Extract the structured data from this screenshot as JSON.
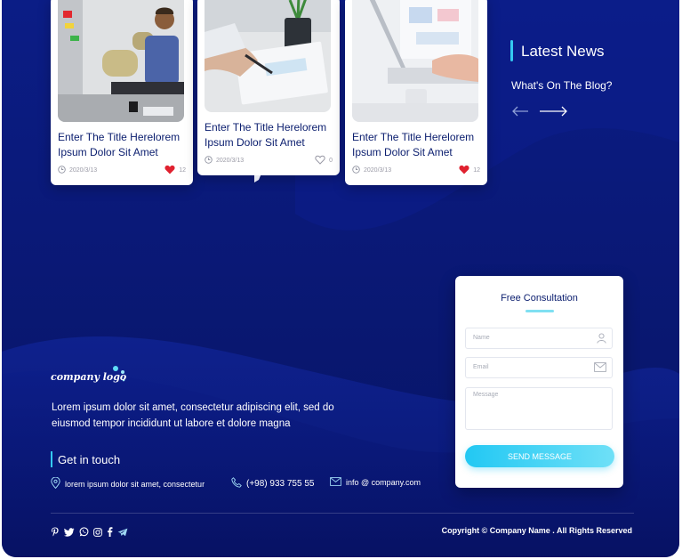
{
  "blog": {
    "cards": [
      {
        "title": "Enter The Title Herelorem Ipsum Dolor Sit Amet",
        "date": "2020/3/13",
        "likes": "12",
        "liked": true
      },
      {
        "title": "Enter The Title Herelorem Ipsum Dolor Sit Amet",
        "date": "2020/3/13",
        "likes": "0",
        "liked": false
      },
      {
        "title": "Enter The Title Herelorem Ipsum Dolor Sit Amet",
        "date": "2020/3/13",
        "likes": "12",
        "liked": true
      }
    ]
  },
  "news": {
    "title": "Latest News",
    "subtitle": "What's On The Blog?"
  },
  "consultation": {
    "title": "Free Consultation",
    "name_placeholder": "Name",
    "email_placeholder": "Email",
    "message_placeholder": "Message",
    "submit_label": "SEND MESSAGE"
  },
  "footer": {
    "logo_text": "company logo",
    "about": "Lorem ipsum dolor sit amet, consectetur adipiscing elit, sed do eiusmod tempor incididunt ut labore et dolore magna",
    "get_in_touch": "Get in touch",
    "address": "lorem ipsum dolor sit amet, consectetur",
    "phone": "(+98) 933 755 55",
    "email": "info @ company.com",
    "copyright": "Copyright © Company Name . All Rights Reserved",
    "social_icons": [
      "pinterest-icon",
      "twitter-icon",
      "whatsapp-icon",
      "instagram-icon",
      "facebook-icon",
      "telegram-icon"
    ]
  },
  "colors": {
    "background": "#0a1978",
    "accent": "#35c9f0",
    "heart": "#e0212f",
    "title_text": "#0a1d6e"
  }
}
